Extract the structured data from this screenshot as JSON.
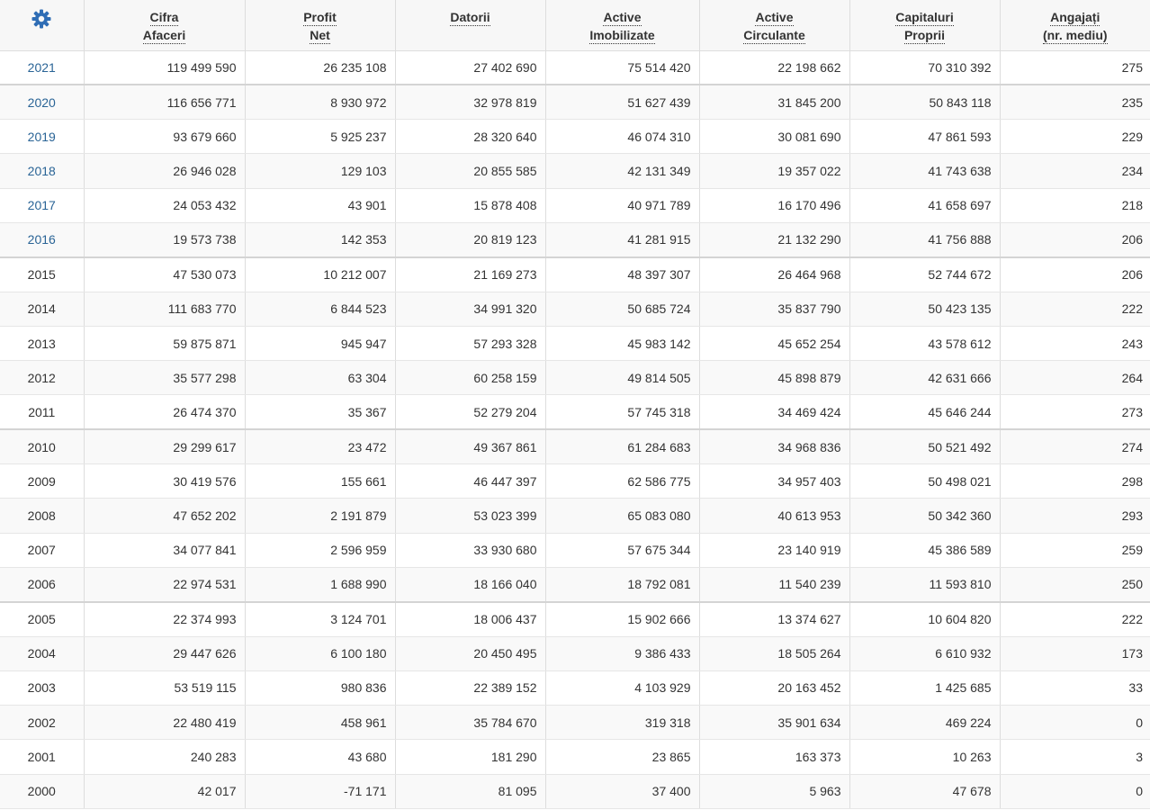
{
  "settings_icon": "gear-icon",
  "accent_color": "#2f6db5",
  "link_color": "#2a6496",
  "headers": [
    {
      "line1": "Cifra",
      "line2": "Afaceri"
    },
    {
      "line1": "Profit",
      "line2": "Net"
    },
    {
      "line1": "Datorii",
      "line2": ""
    },
    {
      "line1": "Active",
      "line2": "Imobilizate"
    },
    {
      "line1": "Active",
      "line2": "Circulante"
    },
    {
      "line1": "Capitaluri",
      "line2": "Proprii"
    },
    {
      "line1": "Angajați",
      "line2": "(nr. mediu)"
    }
  ],
  "rows": [
    {
      "year": "2021",
      "link": true,
      "values": [
        "119 499 590",
        "26 235 108",
        "27 402 690",
        "75 514 420",
        "22 198 662",
        "70 310 392",
        "275"
      ]
    },
    {
      "year": "2020",
      "link": true,
      "values": [
        "116 656 771",
        "8 930 972",
        "32 978 819",
        "51 627 439",
        "31 845 200",
        "50 843 118",
        "235"
      ]
    },
    {
      "year": "2019",
      "link": true,
      "values": [
        "93 679 660",
        "5 925 237",
        "28 320 640",
        "46 074 310",
        "30 081 690",
        "47 861 593",
        "229"
      ]
    },
    {
      "year": "2018",
      "link": true,
      "values": [
        "26 946 028",
        "129 103",
        "20 855 585",
        "42 131 349",
        "19 357 022",
        "41 743 638",
        "234"
      ]
    },
    {
      "year": "2017",
      "link": true,
      "values": [
        "24 053 432",
        "43 901",
        "15 878 408",
        "40 971 789",
        "16 170 496",
        "41 658 697",
        "218"
      ]
    },
    {
      "year": "2016",
      "link": true,
      "values": [
        "19 573 738",
        "142 353",
        "20 819 123",
        "41 281 915",
        "21 132 290",
        "41 756 888",
        "206"
      ]
    },
    {
      "year": "2015",
      "link": false,
      "values": [
        "47 530 073",
        "10 212 007",
        "21 169 273",
        "48 397 307",
        "26 464 968",
        "52 744 672",
        "206"
      ]
    },
    {
      "year": "2014",
      "link": false,
      "values": [
        "111 683 770",
        "6 844 523",
        "34 991 320",
        "50 685 724",
        "35 837 790",
        "50 423 135",
        "222"
      ]
    },
    {
      "year": "2013",
      "link": false,
      "values": [
        "59 875 871",
        "945 947",
        "57 293 328",
        "45 983 142",
        "45 652 254",
        "43 578 612",
        "243"
      ]
    },
    {
      "year": "2012",
      "link": false,
      "values": [
        "35 577 298",
        "63 304",
        "60 258 159",
        "49 814 505",
        "45 898 879",
        "42 631 666",
        "264"
      ]
    },
    {
      "year": "2011",
      "link": false,
      "values": [
        "26 474 370",
        "35 367",
        "52 279 204",
        "57 745 318",
        "34 469 424",
        "45 646 244",
        "273"
      ]
    },
    {
      "year": "2010",
      "link": false,
      "values": [
        "29 299 617",
        "23 472",
        "49 367 861",
        "61 284 683",
        "34 968 836",
        "50 521 492",
        "274"
      ]
    },
    {
      "year": "2009",
      "link": false,
      "values": [
        "30 419 576",
        "155 661",
        "46 447 397",
        "62 586 775",
        "34 957 403",
        "50 498 021",
        "298"
      ]
    },
    {
      "year": "2008",
      "link": false,
      "values": [
        "47 652 202",
        "2 191 879",
        "53 023 399",
        "65 083 080",
        "40 613 953",
        "50 342 360",
        "293"
      ]
    },
    {
      "year": "2007",
      "link": false,
      "values": [
        "34 077 841",
        "2 596 959",
        "33 930 680",
        "57 675 344",
        "23 140 919",
        "45 386 589",
        "259"
      ]
    },
    {
      "year": "2006",
      "link": false,
      "values": [
        "22 974 531",
        "1 688 990",
        "18 166 040",
        "18 792 081",
        "11 540 239",
        "11 593 810",
        "250"
      ]
    },
    {
      "year": "2005",
      "link": false,
      "values": [
        "22 374 993",
        "3 124 701",
        "18 006 437",
        "15 902 666",
        "13 374 627",
        "10 604 820",
        "222"
      ]
    },
    {
      "year": "2004",
      "link": false,
      "values": [
        "29 447 626",
        "6 100 180",
        "20 450 495",
        "9 386 433",
        "18 505 264",
        "6 610 932",
        "173"
      ]
    },
    {
      "year": "2003",
      "link": false,
      "values": [
        "53 519 115",
        "980 836",
        "22 389 152",
        "4 103 929",
        "20 163 452",
        "1 425 685",
        "33"
      ]
    },
    {
      "year": "2002",
      "link": false,
      "values": [
        "22 480 419",
        "458 961",
        "35 784 670",
        "319 318",
        "35 901 634",
        "469 224",
        "0"
      ]
    },
    {
      "year": "2001",
      "link": false,
      "values": [
        "240 283",
        "43 680",
        "181 290",
        "23 865",
        "163 373",
        "10 263",
        "3"
      ]
    },
    {
      "year": "2000",
      "link": false,
      "values": [
        "42 017",
        "-71 171",
        "81 095",
        "37 400",
        "5 963",
        "47 678",
        "0"
      ]
    }
  ]
}
